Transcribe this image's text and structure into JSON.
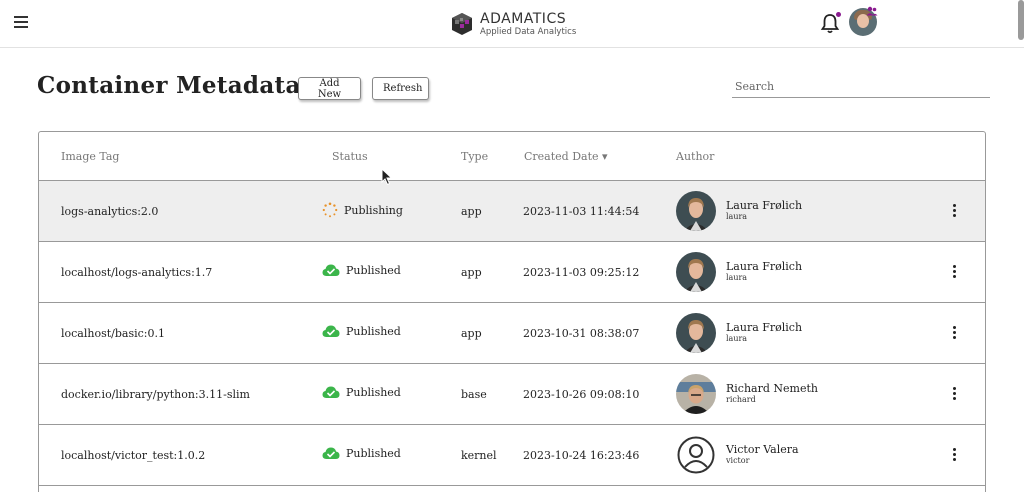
{
  "header": {
    "brand_name": "ADAMATICS",
    "brand_tagline": "Applied Data Analytics"
  },
  "page": {
    "title": "Container Metadata",
    "add_new_label": "Add New",
    "refresh_label": "Refresh",
    "search_placeholder": "Search"
  },
  "table": {
    "columns": {
      "image_tag": "Image Tag",
      "status": "Status",
      "type": "Type",
      "created_date": "Created Date",
      "author": "Author"
    },
    "sort_indicator": "▾",
    "rows": [
      {
        "image_tag": "logs-analytics:2.0",
        "status": "Publishing",
        "status_icon": "spinner-icon",
        "type": "app",
        "created": "2023-11-03 11:44:54",
        "author_name": "Laura Frølich",
        "author_user": "laura",
        "avatar": "photo-laura"
      },
      {
        "image_tag": "localhost/logs-analytics:1.7",
        "status": "Published",
        "status_icon": "cloud-check-icon",
        "type": "app",
        "created": "2023-11-03 09:25:12",
        "author_name": "Laura Frølich",
        "author_user": "laura",
        "avatar": "photo-laura"
      },
      {
        "image_tag": "localhost/basic:0.1",
        "status": "Published",
        "status_icon": "cloud-check-icon",
        "type": "app",
        "created": "2023-10-31 08:38:07",
        "author_name": "Laura Frølich",
        "author_user": "laura",
        "avatar": "photo-laura"
      },
      {
        "image_tag": "docker.io/library/python:3.11-slim",
        "status": "Published",
        "status_icon": "cloud-check-icon",
        "type": "base",
        "created": "2023-10-26 09:08:10",
        "author_name": "Richard Nemeth",
        "author_user": "richard",
        "avatar": "photo-richard"
      },
      {
        "image_tag": "localhost/victor_test:1.0.2",
        "status": "Published",
        "status_icon": "cloud-check-icon",
        "type": "kernel",
        "created": "2023-10-24 16:23:46",
        "author_name": "Victor Valera",
        "author_user": "victor",
        "avatar": "default-user-icon"
      }
    ]
  },
  "colors": {
    "published_green": "#3bb54a",
    "publishing_orange": "#e8932b",
    "notification_dot": "#8a1b8f"
  }
}
